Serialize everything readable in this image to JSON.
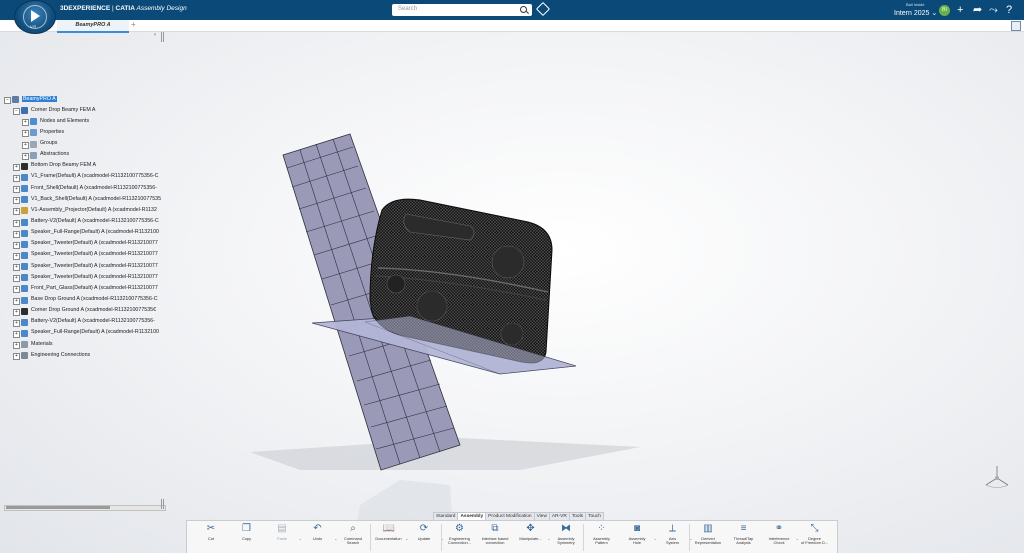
{
  "top_bar": {
    "brand_prefix": "3DEXPERIENCE",
    "brand_separator": " | ",
    "brand_product": "CATIA",
    "brand_app": " Assembly Design",
    "search_placeholder": "Search",
    "user_name": "Ball Inside",
    "tenant": "Intern 2025 ⌄",
    "avatar_initials": "BI",
    "compass_label": "V.R",
    "colors": {
      "bar": "#0b4a78",
      "accent": "#3a8ed4"
    },
    "icons": [
      "tag-icon",
      "add-icon",
      "share-icon",
      "collaboration-icon",
      "help-icon"
    ]
  },
  "tabs": {
    "active_label": "BeamyPRO A",
    "add_label": "+"
  },
  "tree": {
    "collapse_arrow": "‹",
    "items": [
      {
        "label": "BeamyPRO A",
        "level": 0,
        "icon": "product-icon",
        "color": "#5d7fa6",
        "selected": true
      },
      {
        "label": "Corner Drop Beamy FEM A",
        "level": 1,
        "icon": "fem-icon",
        "color": "#3e6fb0"
      },
      {
        "label": "Nodes and Elements",
        "level": 2,
        "icon": "mesh-icon",
        "color": "#4b8fd0"
      },
      {
        "label": "Properties",
        "level": 2,
        "icon": "properties-icon",
        "color": "#6b9ccf"
      },
      {
        "label": "Groups",
        "level": 2,
        "icon": "groups-icon",
        "color": "#9aa8b5"
      },
      {
        "label": "Abstractions",
        "level": 2,
        "icon": "abstractions-icon",
        "color": "#8aa0b8"
      },
      {
        "label": "Bottom Drop Beamy FEM A",
        "level": 1,
        "icon": "fem-icon",
        "color": "#2e2e2e"
      },
      {
        "label": "V1_Frame(Default) A (xcadmodel-R1132100775356-C",
        "level": 1,
        "icon": "part-icon",
        "color": "#4a88c8"
      },
      {
        "label": "Front_Shell(Default) A (xcadmodel-R1132100775356-",
        "level": 1,
        "icon": "part-icon",
        "color": "#4a88c8"
      },
      {
        "label": "V1_Back_Shell(Default) A (xcadmodel-R113210077535",
        "level": 1,
        "icon": "part-icon",
        "color": "#4a88c8"
      },
      {
        "label": "V1-Assembly_Projector(Default) A (xcadmodel-R1132",
        "level": 1,
        "icon": "assembly-icon",
        "color": "#c8a33c"
      },
      {
        "label": "Battery-V2(Default) A (xcadmodel-R1132100775356-C",
        "level": 1,
        "icon": "part-icon",
        "color": "#4a88c8"
      },
      {
        "label": "Speaker_Full-Range(Default) A (xcadmodel-R1132100",
        "level": 1,
        "icon": "part-icon",
        "color": "#4a88c8"
      },
      {
        "label": "Speaker_Tweeter(Default) A (xcadmodel-R113210077",
        "level": 1,
        "icon": "part-icon",
        "color": "#4a88c8"
      },
      {
        "label": "Speaker_Tweeter(Default) A (xcadmodel-R113210077",
        "level": 1,
        "icon": "part-icon",
        "color": "#4a88c8"
      },
      {
        "label": "Speaker_Tweeter(Default) A (xcadmodel-R113210077",
        "level": 1,
        "icon": "part-icon",
        "color": "#4a88c8"
      },
      {
        "label": "Speaker_Tweeter(Default) A (xcadmodel-R113210077",
        "level": 1,
        "icon": "part-icon",
        "color": "#4a88c8"
      },
      {
        "label": "Front_Part_Glass(Default) A (xcadmodel-R113210077",
        "level": 1,
        "icon": "part-icon",
        "color": "#4a88c8"
      },
      {
        "label": "Base Drop Ground A (xcadmodel-R1132100775356-C",
        "level": 1,
        "icon": "part-icon",
        "color": "#4a88c8"
      },
      {
        "label": "Corner Drop Ground A (xcadmodel-R113210077535€",
        "level": 1,
        "icon": "part-icon",
        "color": "#2e2e2e"
      },
      {
        "label": "Battery-V2(Default) A (xcadmodel-R1132100775356-",
        "level": 1,
        "icon": "part-icon",
        "color": "#4a88c8"
      },
      {
        "label": "Speaker_Full-Range(Default) A (xcadmodel-R1132100",
        "level": 1,
        "icon": "part-icon",
        "color": "#4a88c8"
      },
      {
        "label": "Materials",
        "level": 1,
        "icon": "materials-icon",
        "color": "#8c9aa8"
      },
      {
        "label": "Engineering Connections",
        "level": 1,
        "icon": "connections-icon",
        "color": "#7b8a99"
      }
    ]
  },
  "action_tabs": [
    "Standard",
    "Assembly",
    "Product Modification",
    "View",
    "AR-VR",
    "Tools",
    "Touch"
  ],
  "active_action_tab": "Assembly",
  "actions": [
    {
      "label": "Cut",
      "icon": "scissors-icon",
      "glyph": "✂",
      "disabled": false,
      "dropdown": false
    },
    {
      "label": "Copy",
      "icon": "copy-icon",
      "glyph": "❐",
      "disabled": false,
      "dropdown": false
    },
    {
      "label": "Paste",
      "icon": "paste-icon",
      "glyph": "▤",
      "disabled": true,
      "dropdown": true
    },
    {
      "label": "Undo",
      "icon": "undo-icon",
      "glyph": "↶",
      "disabled": false,
      "dropdown": true
    },
    {
      "label": "Command\nSearch",
      "icon": "command-search-icon",
      "glyph": "⌕",
      "disabled": false,
      "dropdown": false
    },
    {
      "label": "Documentation",
      "icon": "documentation-icon",
      "glyph": "📖",
      "disabled": false,
      "dropdown": true
    },
    {
      "label": "Update",
      "icon": "update-icon",
      "glyph": "⟳",
      "disabled": false,
      "dropdown": true
    },
    {
      "label": "Engineering\nConnection...",
      "icon": "engineering-connection-icon",
      "glyph": "⚙",
      "disabled": false,
      "dropdown": false
    },
    {
      "label": "Interface based\nconnection",
      "icon": "interface-connection-icon",
      "glyph": "⧉",
      "disabled": false,
      "dropdown": false
    },
    {
      "label": "Manipulate...",
      "icon": "manipulate-icon",
      "glyph": "✥",
      "disabled": false,
      "dropdown": true
    },
    {
      "label": "Assembly\nSymmetry",
      "icon": "assembly-symmetry-icon",
      "glyph": "⧓",
      "disabled": false,
      "dropdown": false
    },
    {
      "label": "Assembly\nPattern",
      "icon": "assembly-pattern-icon",
      "glyph": "⁘",
      "disabled": false,
      "dropdown": false
    },
    {
      "label": "Assembly\nHole",
      "icon": "assembly-hole-icon",
      "glyph": "◙",
      "disabled": false,
      "dropdown": true
    },
    {
      "label": "Axis\nSystem",
      "icon": "axis-system-icon",
      "glyph": "⟂",
      "disabled": false,
      "dropdown": true
    },
    {
      "label": "Derived\nRepresentation",
      "icon": "derived-representation-icon",
      "glyph": "▥",
      "disabled": false,
      "dropdown": false
    },
    {
      "label": "Thread/Tap\nAnalysis",
      "icon": "thread-tap-icon",
      "glyph": "≡",
      "disabled": false,
      "dropdown": false
    },
    {
      "label": "Interference\nCheck",
      "icon": "interference-check-icon",
      "glyph": "⚭",
      "disabled": false,
      "dropdown": true
    },
    {
      "label": "Degree\nof Freedom D...",
      "icon": "degree-of-freedom-icon",
      "glyph": "⤡",
      "disabled": false,
      "dropdown": false
    }
  ]
}
